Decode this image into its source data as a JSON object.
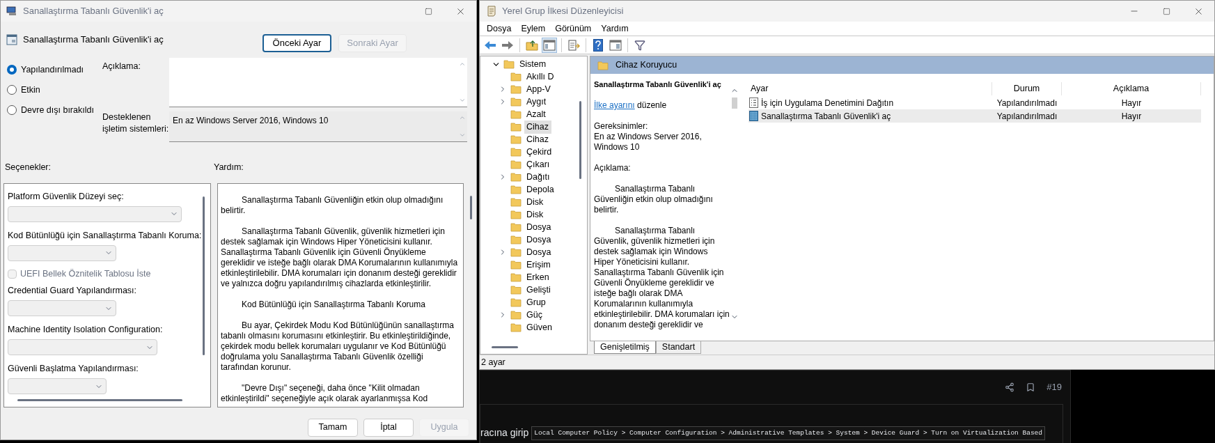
{
  "dialog": {
    "title": "Sanallaştırma Tabanlı Güvenlik'i aç",
    "heading": "Sanallaştırma Tabanlı Güvenlik'i aç",
    "nav_buttons": [
      {
        "label": "Önceki Ayar",
        "disabled": false
      },
      {
        "label": "Sonraki Ayar",
        "disabled": true
      }
    ],
    "states": [
      {
        "label": "Yapılandırılmadı",
        "selected": true
      },
      {
        "label": "Etkin",
        "selected": false
      },
      {
        "label": "Devre dışı bırakıldı",
        "selected": false
      }
    ],
    "comment_label": "Açıklama:",
    "supported_label": "Desteklenen işletim sistemleri:",
    "supported_value": "En az Windows Server 2016, Windows 10",
    "options_label": "Seçenekler:",
    "help_label": "Yardım:",
    "options": [
      {
        "kind": "dropdown",
        "label": "Platform Güvenlik Düzeyi seç:",
        "disabled": true
      },
      {
        "kind": "dropdown",
        "label": "Kod Bütünlüğü için Sanallaştırma Tabanlı Koruma:",
        "disabled": true
      },
      {
        "kind": "checkbox",
        "label": "UEFI Bellek Öznitelik Tablosu İste",
        "checked": false,
        "disabled": true
      },
      {
        "kind": "dropdown",
        "label": "Credential Guard Yapılandırması:",
        "disabled": true
      },
      {
        "kind": "dropdown",
        "label": "Machine Identity Isolation Configuration:",
        "disabled": true
      },
      {
        "kind": "dropdown",
        "label": "Güvenli Başlatma Yapılandırması:",
        "disabled": true
      }
    ],
    "help_paragraphs": [
      "Sanallaştırma Tabanlı Güvenliğin etkin olup olmadığını belirtir.",
      "Sanallaştırma Tabanlı Güvenlik, güvenlik hizmetleri için destek sağlamak için Windows Hiper Yöneticisini kullanır. Sanallaştırma Tabanlı Güvenlik için Güvenli Önyükleme gereklidir ve isteğe bağlı olarak DMA Korumalarının kullanımıyla etkinleştirilebilir. DMA korumaları için donanım desteği gereklidir ve yalnızca doğru yapılandırılmış cihazlarda etkinleştirilir.",
      "Kod Bütünlüğü için Sanallaştırma Tabanlı Koruma",
      "Bu ayar, Çekirdek Modu Kod Bütünlüğünün sanallaştırma tabanlı olmasını korumasını etkinleştirir. Bu etkinleştirildiğinde, çekirdek modu bellek korumaları uygulanır ve Kod Bütünlüğü doğrulama yolu Sanallaştırma Tabanlı Güvenlik özelliği tarafından korunur.",
      "\"Devre Dışı\" seçeneği, daha önce \"Kilit olmadan etkinleştirildi\" seçeneğiyle açık olarak ayarlanmışsa Kod"
    ],
    "buttons": [
      {
        "label": "Tamam",
        "disabled": false
      },
      {
        "label": "İptal",
        "disabled": false
      },
      {
        "label": "Uygula",
        "disabled": true
      }
    ]
  },
  "editor": {
    "title": "Yerel Grup İlkesi Düzenleyicisi",
    "menu": [
      "Dosya",
      "Eylem",
      "Görünüm",
      "Yardım"
    ],
    "tree": {
      "label": "Sistem",
      "expanded": true,
      "children": [
        {
          "label": "Akıllı D",
          "expandable": false,
          "selected": false
        },
        {
          "label": "App-V",
          "expandable": true,
          "selected": false
        },
        {
          "label": "Aygıt",
          "expandable": true,
          "selected": false
        },
        {
          "label": "Azalt",
          "expandable": false,
          "selected": false
        },
        {
          "label": "Cihaz",
          "expandable": false,
          "selected": true
        },
        {
          "label": "Cihaz",
          "expandable": false,
          "selected": false
        },
        {
          "label": "Çekird",
          "expandable": false,
          "selected": false
        },
        {
          "label": "Çıkarı",
          "expandable": false,
          "selected": false
        },
        {
          "label": "Dağıtı",
          "expandable": true,
          "selected": false
        },
        {
          "label": "Depola",
          "expandable": false,
          "selected": false
        },
        {
          "label": "Disk",
          "expandable": false,
          "selected": false
        },
        {
          "label": "Disk",
          "expandable": false,
          "selected": false
        },
        {
          "label": "Dosya",
          "expandable": false,
          "selected": false
        },
        {
          "label": "Dosya",
          "expandable": false,
          "selected": false
        },
        {
          "label": "Dosya",
          "expandable": true,
          "selected": false
        },
        {
          "label": "Erişim",
          "expandable": false,
          "selected": false
        },
        {
          "label": "Erken",
          "expandable": false,
          "selected": false
        },
        {
          "label": "Gelişti",
          "expandable": false,
          "selected": false
        },
        {
          "label": "Grup",
          "expandable": false,
          "selected": false
        },
        {
          "label": "Güç",
          "expandable": true,
          "selected": false
        },
        {
          "label": "Güven",
          "expandable": false,
          "selected": false
        }
      ]
    },
    "header": "Cihaz Koruyucu",
    "extended": {
      "title": "Sanallaştırma Tabanlı Güvenlik'i aç",
      "link": "İlke ayarını",
      "link_suffix": "düzenle",
      "requirements_label": "Gereksinimler:",
      "requirements": "En az Windows Server 2016, Windows 10",
      "description_label": "Açıklama:",
      "paragraphs": [
        "Sanallaştırma Tabanlı Güvenliğin etkin olup olmadığını belirtir.",
        "Sanallaştırma Tabanlı Güvenlik, güvenlik hizmetleri için destek sağlamak için Windows Hiper Yöneticisini kullanır. Sanallaştırma Tabanlı Güvenlik için Güvenli Önyükleme gereklidir ve isteğe bağlı olarak DMA Korumalarının kullanımıyla etkinleştirilebilir. DMA korumaları için donanım desteği gereklidir ve"
      ]
    },
    "columns": [
      "Ayar",
      "Durum",
      "Açıklama"
    ],
    "rows": [
      {
        "kind": "list",
        "setting": "İş için Uygulama Denetimini Dağıtın",
        "state": "Yapılandırılmadı",
        "comment": "Hayır",
        "selected": false
      },
      {
        "kind": "policy",
        "setting": "Sanallaştırma Tabanlı Güvenlik'i aç",
        "state": "Yapılandırılmadı",
        "comment": "Hayır",
        "selected": true
      }
    ],
    "tabs": [
      {
        "label": "Genişletilmiş",
        "selected": true
      },
      {
        "label": "Standart",
        "selected": false
      }
    ],
    "status_bar": "2 ayar"
  },
  "forum": {
    "post_number": "#19",
    "text": "racına girip",
    "code": "Local Computer Policy > Computer Configuration > Administrative Templates > System > Device Guard > Turn on Virtualization Based"
  }
}
